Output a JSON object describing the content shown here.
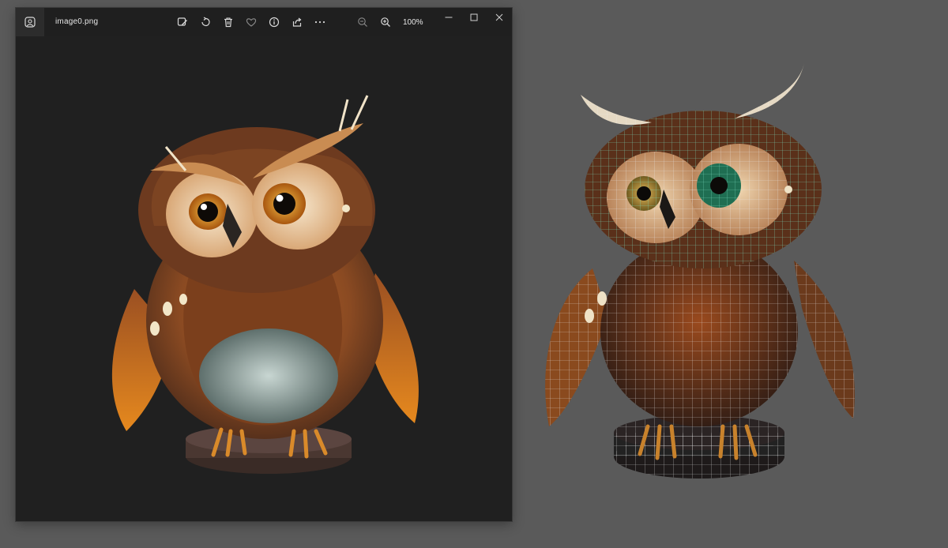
{
  "viewer": {
    "filename": "image0.png",
    "zoom_label": "100%"
  },
  "icons": {
    "app": "photos-app-icon",
    "edit": "edit-image-icon",
    "rotate": "rotate-icon",
    "delete": "delete-icon",
    "favorite": "heart-icon",
    "info": "info-icon",
    "share": "share-icon",
    "more": "more-icon",
    "zoom_out": "zoom-out-icon",
    "zoom_in": "zoom-in-icon",
    "minimize": "minimize-icon",
    "maximize": "maximize-icon",
    "close": "close-icon"
  },
  "colors": {
    "desktop_bg": "#5a5a5a",
    "window_bg": "#202020",
    "icon_color": "#d8d8d8",
    "wireframe": "#e8e8e8",
    "wireframe_accent": "#7de0c0"
  }
}
